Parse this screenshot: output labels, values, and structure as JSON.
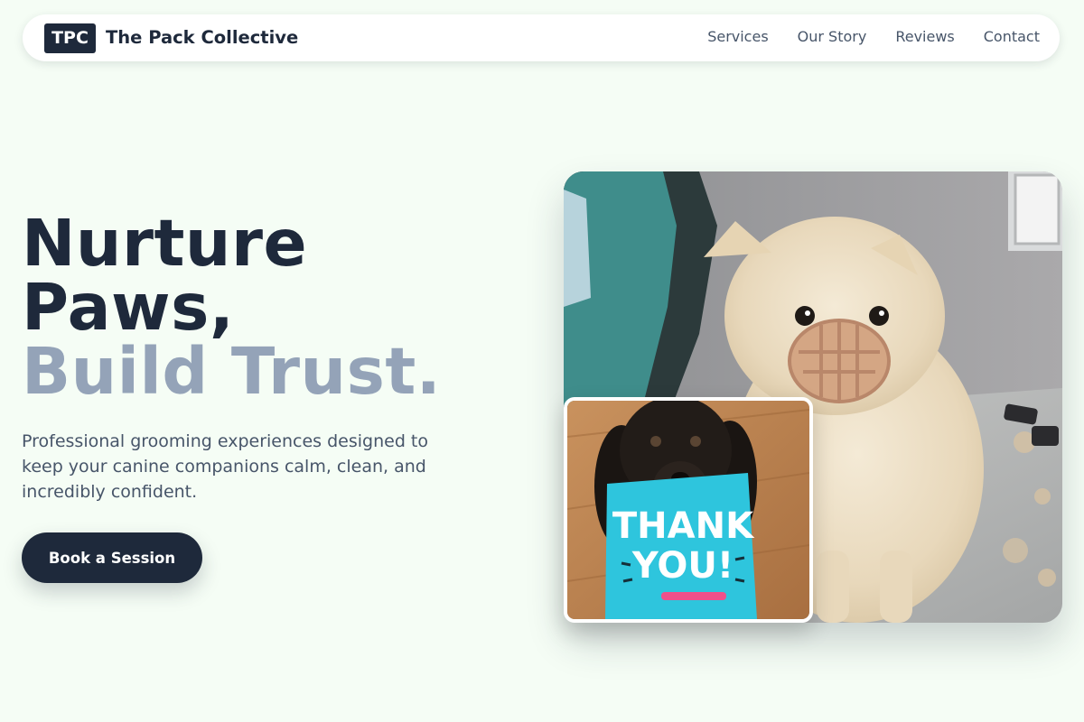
{
  "header": {
    "logo_text": "TPC",
    "brand_name": "The Pack Collective",
    "nav": [
      "Services",
      "Our Story",
      "Reviews",
      "Contact"
    ]
  },
  "hero": {
    "title_lines": [
      "Nurture",
      "Paws,",
      "Build Trust."
    ],
    "subtitle": "Professional grooming experiences designed to keep your canine companions calm, clean, and incredibly confident.",
    "cta_label": "Book a Session"
  },
  "images": {
    "main_alt": "Cream Pomeranian wearing a muzzle on a grooming table",
    "inset_alt": "Black spaniel holding a thank you card",
    "card_text_line1": "THANK",
    "card_text_line2": "YOU!"
  },
  "colors": {
    "background": "#f5fdf5",
    "primary": "#1e293b",
    "accent_text": "#94a3b8",
    "body_text": "#475569",
    "card_blue": "#2ec5dd"
  }
}
